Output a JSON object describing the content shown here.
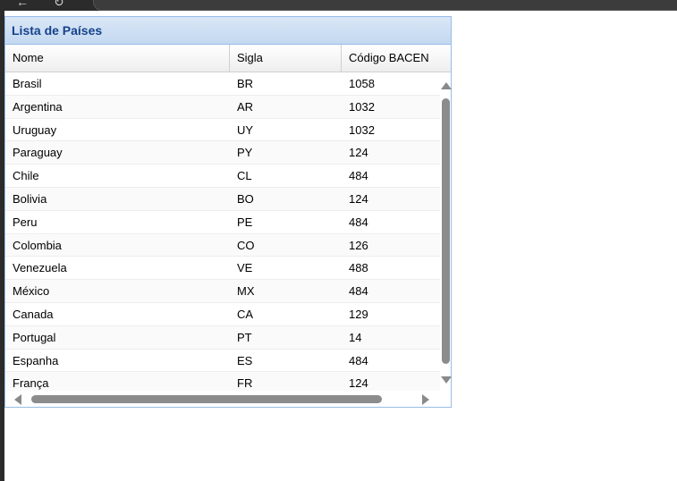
{
  "panel": {
    "title": "Lista de Países"
  },
  "grid": {
    "columns": [
      "Nome",
      "Sigla",
      "Código BACEN"
    ],
    "rows": [
      [
        "Brasil",
        "BR",
        "1058"
      ],
      [
        "Argentina",
        "AR",
        "1032"
      ],
      [
        "Uruguay",
        "UY",
        "1032"
      ],
      [
        "Paraguay",
        "PY",
        "124"
      ],
      [
        "Chile",
        "CL",
        "484"
      ],
      [
        "Bolivia",
        "BO",
        "124"
      ],
      [
        "Peru",
        "PE",
        "484"
      ],
      [
        "Colombia",
        "CO",
        "126"
      ],
      [
        "Venezuela",
        "VE",
        "488"
      ],
      [
        "México",
        "MX",
        "484"
      ],
      [
        "Canada",
        "CA",
        "129"
      ],
      [
        "Portugal",
        "PT",
        "14"
      ],
      [
        "Espanha",
        "ES",
        "484"
      ],
      [
        "França",
        "FR",
        "124"
      ]
    ]
  },
  "colors": {
    "header_text": "#15428b",
    "panel_border": "#99bbe8",
    "scroll_thumb": "#8c8c8c"
  },
  "icons": [
    "scroll-up-icon",
    "scroll-down-icon",
    "scroll-left-icon",
    "scroll-right-icon"
  ]
}
